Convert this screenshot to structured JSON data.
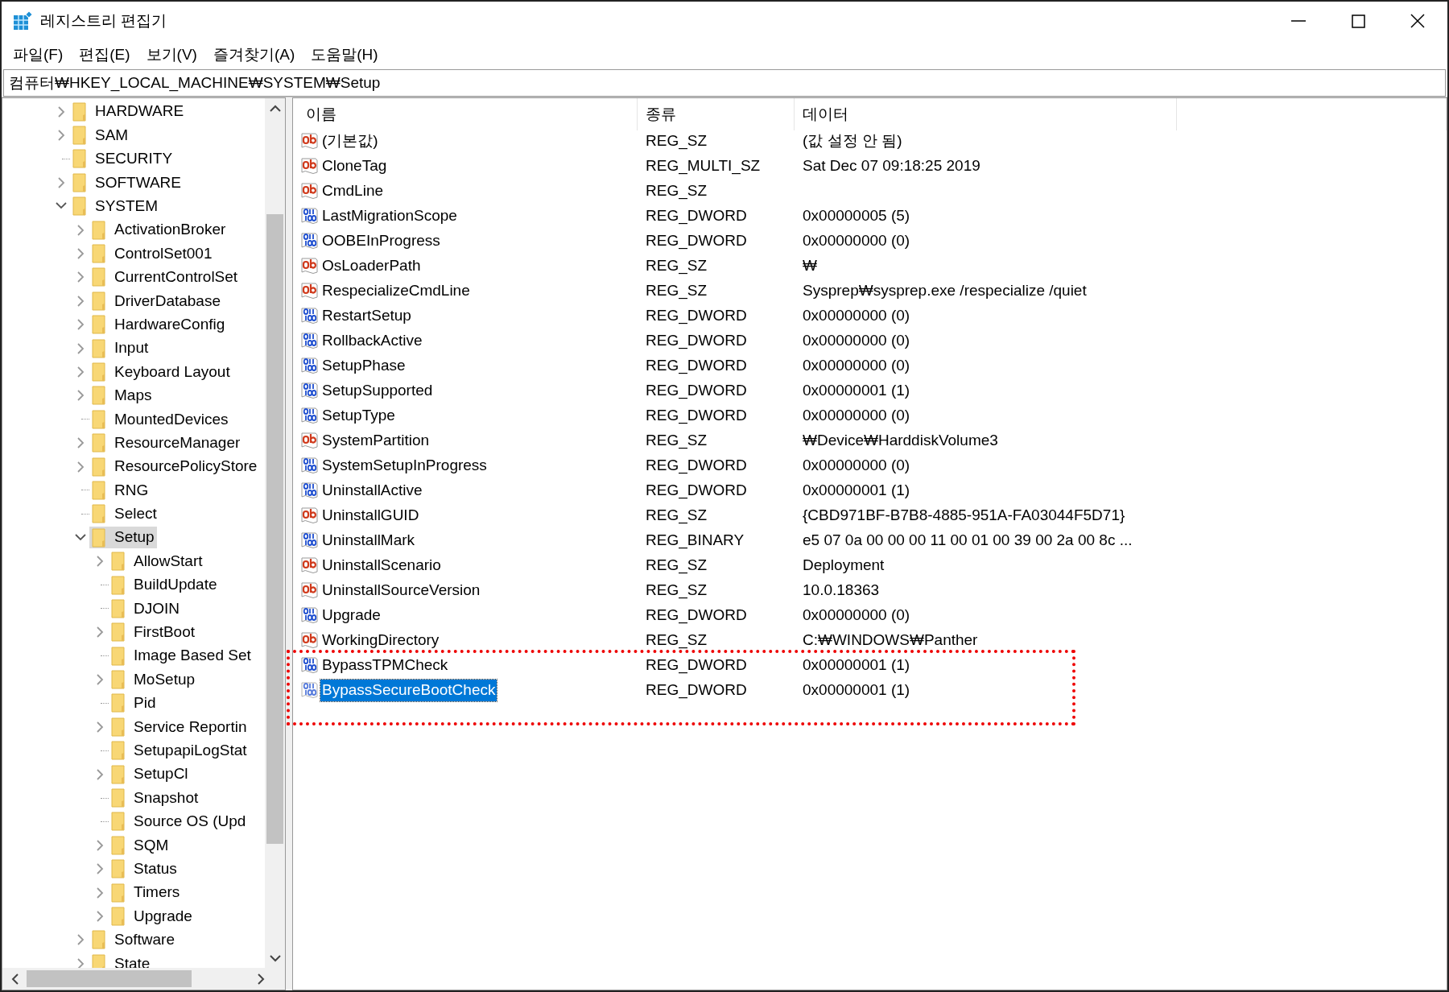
{
  "window": {
    "title": "레지스트리 편집기"
  },
  "menu": [
    "파일(F)",
    "편집(E)",
    "보기(V)",
    "즐겨찾기(A)",
    "도움말(H)"
  ],
  "address": "컴퓨터₩HKEY_LOCAL_MACHINE₩SYSTEM₩Setup",
  "tree": [
    {
      "label": "HARDWARE",
      "kind": "collapsed",
      "selected": false
    },
    {
      "label": "SAM",
      "kind": "collapsed",
      "selected": false
    },
    {
      "label": "SECURITY",
      "kind": "leaf",
      "selected": false
    },
    {
      "label": "SOFTWARE",
      "kind": "collapsed",
      "selected": false
    },
    {
      "label": "SYSTEM",
      "kind": "expanded",
      "selected": false,
      "children": [
        {
          "label": "ActivationBroker",
          "kind": "collapsed",
          "selected": false
        },
        {
          "label": "ControlSet001",
          "kind": "collapsed",
          "selected": false
        },
        {
          "label": "CurrentControlSet",
          "kind": "collapsed",
          "selected": false
        },
        {
          "label": "DriverDatabase",
          "kind": "collapsed",
          "selected": false
        },
        {
          "label": "HardwareConfig",
          "kind": "collapsed",
          "selected": false
        },
        {
          "label": "Input",
          "kind": "collapsed",
          "selected": false
        },
        {
          "label": "Keyboard Layout",
          "kind": "collapsed",
          "selected": false
        },
        {
          "label": "Maps",
          "kind": "collapsed",
          "selected": false
        },
        {
          "label": "MountedDevices",
          "kind": "leaf",
          "selected": false
        },
        {
          "label": "ResourceManager",
          "kind": "collapsed",
          "selected": false
        },
        {
          "label": "ResourcePolicyStore",
          "kind": "collapsed",
          "selected": false
        },
        {
          "label": "RNG",
          "kind": "leaf",
          "selected": false
        },
        {
          "label": "Select",
          "kind": "leaf",
          "selected": false
        },
        {
          "label": "Setup",
          "kind": "expanded",
          "selected": true,
          "children": [
            {
              "label": "AllowStart",
              "kind": "collapsed",
              "selected": false
            },
            {
              "label": "BuildUpdate",
              "kind": "leaf",
              "selected": false
            },
            {
              "label": "DJOIN",
              "kind": "leaf",
              "selected": false
            },
            {
              "label": "FirstBoot",
              "kind": "collapsed",
              "selected": false
            },
            {
              "label": "Image Based Set",
              "kind": "leaf",
              "selected": false
            },
            {
              "label": "MoSetup",
              "kind": "collapsed",
              "selected": false
            },
            {
              "label": "Pid",
              "kind": "leaf",
              "selected": false
            },
            {
              "label": "Service Reportin",
              "kind": "collapsed",
              "selected": false
            },
            {
              "label": "SetupapiLogStat",
              "kind": "leaf",
              "selected": false
            },
            {
              "label": "SetupCl",
              "kind": "collapsed",
              "selected": false
            },
            {
              "label": "Snapshot",
              "kind": "leaf",
              "selected": false
            },
            {
              "label": "Source OS (Upd",
              "kind": "leaf",
              "selected": false
            },
            {
              "label": "SQM",
              "kind": "collapsed",
              "selected": false
            },
            {
              "label": "Status",
              "kind": "collapsed",
              "selected": false
            },
            {
              "label": "Timers",
              "kind": "collapsed",
              "selected": false
            },
            {
              "label": "Upgrade",
              "kind": "collapsed",
              "selected": false
            }
          ]
        },
        {
          "label": "Software",
          "kind": "collapsed",
          "selected": false
        },
        {
          "label": "State",
          "kind": "collapsed",
          "selected": false
        }
      ]
    }
  ],
  "columns": [
    "이름",
    "종류",
    "데이터"
  ],
  "values": [
    {
      "name": "(기본값)",
      "kind": "string",
      "type": "REG_SZ",
      "data": "(값 설정 안 됨)",
      "selected": false,
      "marked": false
    },
    {
      "name": "CloneTag",
      "kind": "string",
      "type": "REG_MULTI_SZ",
      "data": "Sat Dec 07 09:18:25 2019",
      "selected": false,
      "marked": false
    },
    {
      "name": "CmdLine",
      "kind": "string",
      "type": "REG_SZ",
      "selected": false,
      "marked": false
    },
    {
      "name": "LastMigrationScope",
      "kind": "binary",
      "type": "REG_DWORD",
      "data": "0x00000005 (5)",
      "selected": false,
      "marked": false
    },
    {
      "name": "OOBEInProgress",
      "kind": "binary",
      "type": "REG_DWORD",
      "data": "0x00000000 (0)",
      "selected": false,
      "marked": false
    },
    {
      "name": "OsLoaderPath",
      "kind": "string",
      "type": "REG_SZ",
      "data": "₩",
      "selected": false,
      "marked": false
    },
    {
      "name": "RespecializeCmdLine",
      "kind": "string",
      "type": "REG_SZ",
      "data": "Sysprep₩sysprep.exe /respecialize /quiet",
      "selected": false,
      "marked": false
    },
    {
      "name": "RestartSetup",
      "kind": "binary",
      "type": "REG_DWORD",
      "data": "0x00000000 (0)",
      "selected": false,
      "marked": false
    },
    {
      "name": "RollbackActive",
      "kind": "binary",
      "type": "REG_DWORD",
      "data": "0x00000000 (0)",
      "selected": false,
      "marked": false
    },
    {
      "name": "SetupPhase",
      "kind": "binary",
      "type": "REG_DWORD",
      "data": "0x00000000 (0)",
      "selected": false,
      "marked": false
    },
    {
      "name": "SetupSupported",
      "kind": "binary",
      "type": "REG_DWORD",
      "data": "0x00000001 (1)",
      "selected": false,
      "marked": false
    },
    {
      "name": "SetupType",
      "kind": "binary",
      "type": "REG_DWORD",
      "data": "0x00000000 (0)",
      "selected": false,
      "marked": false
    },
    {
      "name": "SystemPartition",
      "kind": "string",
      "type": "REG_SZ",
      "data": "₩Device₩HarddiskVolume3",
      "selected": false,
      "marked": false
    },
    {
      "name": "SystemSetupInProgress",
      "kind": "binary",
      "type": "REG_DWORD",
      "data": "0x00000000 (0)",
      "selected": false,
      "marked": false
    },
    {
      "name": "UninstallActive",
      "kind": "binary",
      "type": "REG_DWORD",
      "data": "0x00000001 (1)",
      "selected": false,
      "marked": false
    },
    {
      "name": "UninstallGUID",
      "kind": "string",
      "type": "REG_SZ",
      "data": "{CBD971BF-B7B8-4885-951A-FA03044F5D71}",
      "selected": false,
      "marked": false
    },
    {
      "name": "UninstallMark",
      "kind": "binary",
      "type": "REG_BINARY",
      "data": "e5 07 0a 00 00 00 11 00 01 00 39 00 2a 00 8c ...",
      "selected": false,
      "marked": false
    },
    {
      "name": "UninstallScenario",
      "kind": "string",
      "type": "REG_SZ",
      "data": "Deployment",
      "selected": false,
      "marked": false
    },
    {
      "name": "UninstallSourceVersion",
      "kind": "string",
      "type": "REG_SZ",
      "data": "10.0.18363",
      "selected": false,
      "marked": false
    },
    {
      "name": "Upgrade",
      "kind": "binary",
      "type": "REG_DWORD",
      "data": "0x00000000 (0)",
      "selected": false,
      "marked": false
    },
    {
      "name": "WorkingDirectory",
      "kind": "string",
      "type": "REG_SZ",
      "data": "C:₩WINDOWS₩Panther",
      "selected": false,
      "marked": false
    },
    {
      "name": "BypassTPMCheck",
      "kind": "binary",
      "type": "REG_DWORD",
      "data": "0x00000001 (1)",
      "selected": false,
      "marked": true
    },
    {
      "name": "BypassSecureBootCheck",
      "kind": "binary",
      "type": "REG_DWORD",
      "data": "0x00000001 (1)",
      "selected": true,
      "marked": true
    }
  ]
}
